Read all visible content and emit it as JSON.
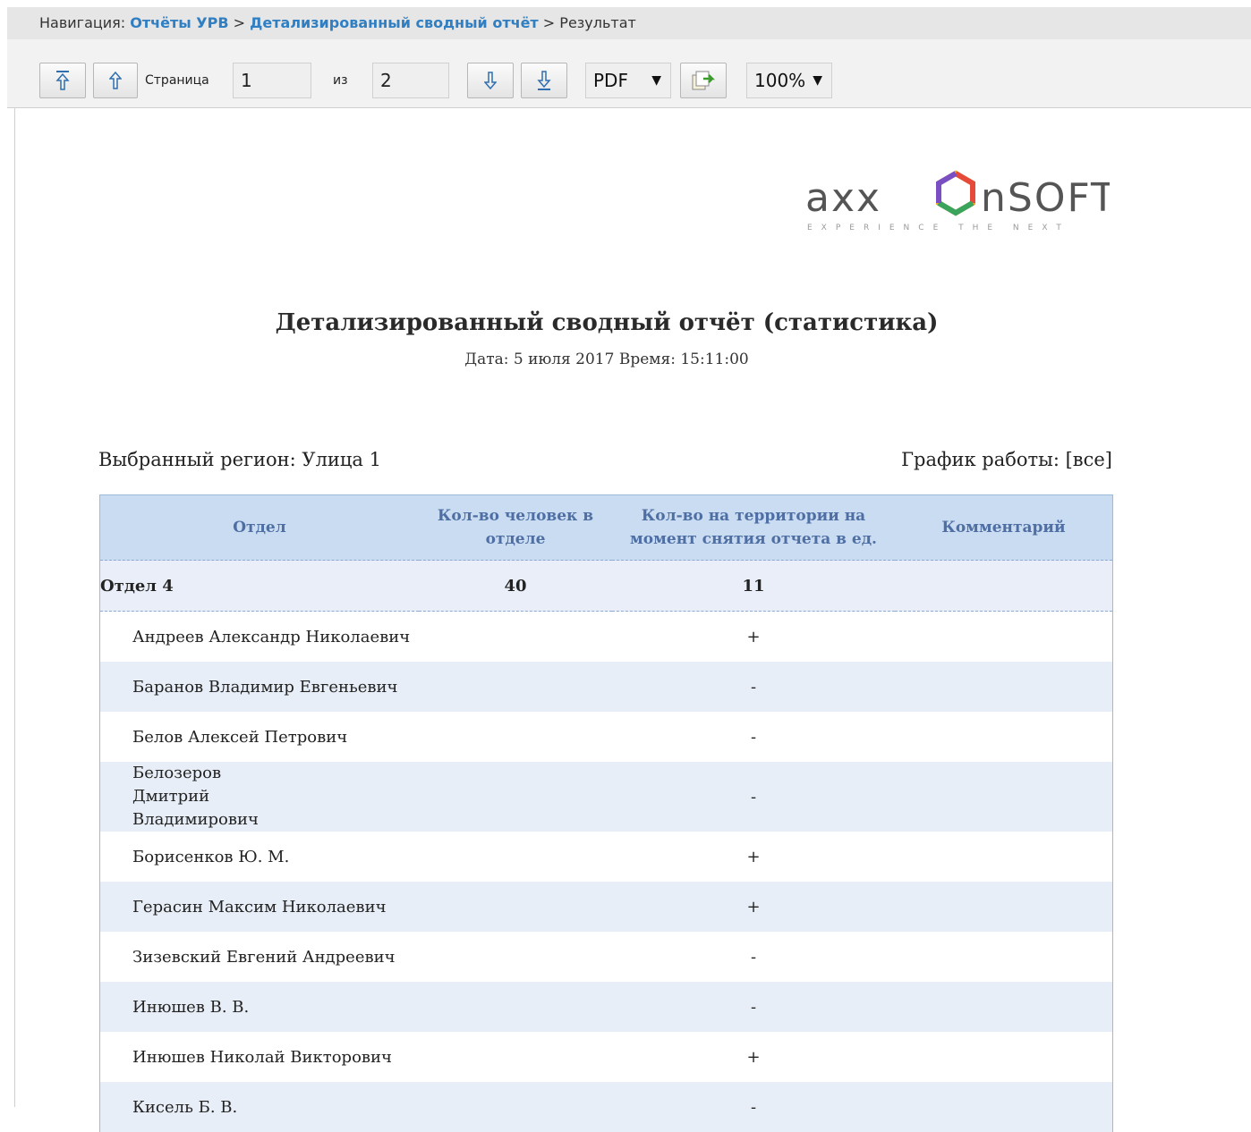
{
  "breadcrumb": {
    "prefix": "Навигация:",
    "link1": "Отчёты УРВ",
    "sep1": ">",
    "link2": "Детализированный сводный отчёт",
    "sep2": ">",
    "current": "Результат"
  },
  "toolbar": {
    "first_page_icon": "first-page-icon",
    "prev_page_icon": "prev-page-icon",
    "page_label": "Страница",
    "page_value": "1",
    "of_label": "из",
    "total_pages": "2",
    "next_page_icon": "next-page-icon",
    "last_page_icon": "last-page-icon",
    "format_value": "PDF",
    "export_icon": "export-icon",
    "zoom_value": "100%"
  },
  "report": {
    "logo_text": "axxonsoft",
    "logo_tagline": "EXPERIENCE THE NEXT",
    "title": "Детализированный сводный отчёт (статистика)",
    "subtitle": "Дата: 5 июля 2017 Время: 15:11:00",
    "region": "Выбранный регион: Улица 1",
    "schedule": "График работы: [все]",
    "columns": {
      "dept": "Отдел",
      "count": "Кол-во человек в отделе",
      "on_site": "Кол-во на территории на момент снятия отчета в ед.",
      "comment": "Комментарий"
    },
    "group": {
      "name": "Отдел 4",
      "count": "40",
      "on_site": "11"
    },
    "rows": [
      {
        "name": "Андреев Александр Николаевич",
        "mark": "+"
      },
      {
        "name": "Баранов Владимир Евгеньевич",
        "mark": "-"
      },
      {
        "name": "Белов Алексей Петрович",
        "mark": "-"
      },
      {
        "name": "Белозеров Дмитрий Владимирович",
        "mark": "-"
      },
      {
        "name": "Борисенков Ю. М.",
        "mark": "+"
      },
      {
        "name": "Герасин Максим Николаевич",
        "mark": "+"
      },
      {
        "name": "Зизевский Евгений Андреевич",
        "mark": "-"
      },
      {
        "name": "Инюшев В. В.",
        "mark": "-"
      },
      {
        "name": "Инюшев Николай Викторович",
        "mark": "+"
      },
      {
        "name": "Кисель Б. В.",
        "mark": "-"
      }
    ]
  }
}
